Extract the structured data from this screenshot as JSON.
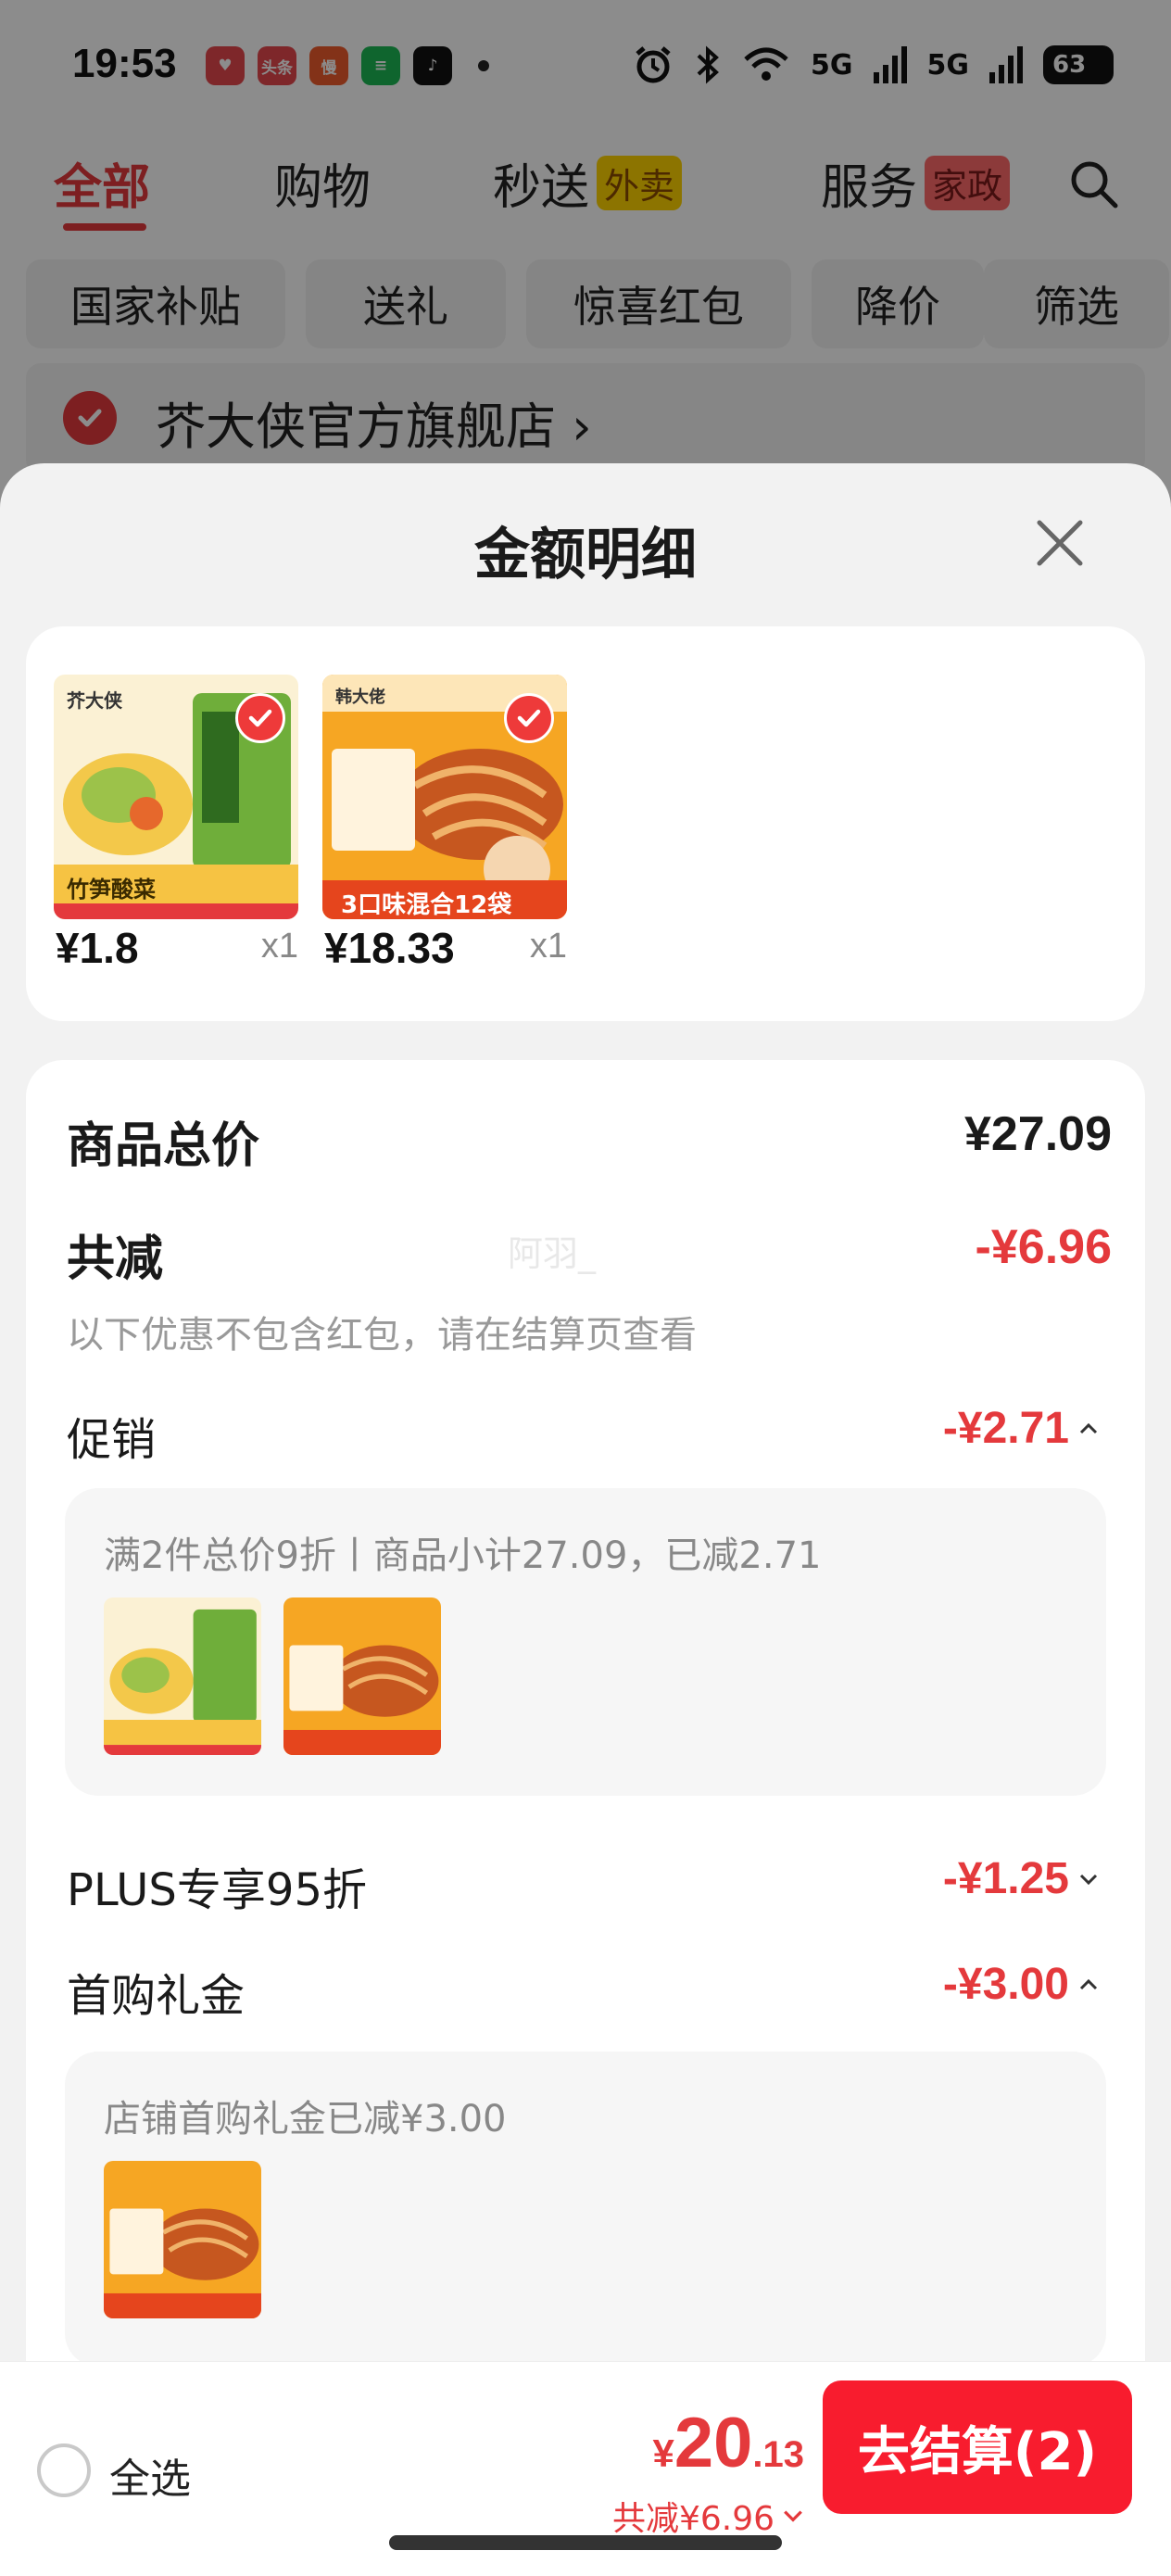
{
  "status_bar": {
    "time": "19:53",
    "apps": [
      {
        "label": "♥",
        "color": "#e5484d"
      },
      {
        "label": "头条",
        "color": "#e5484d"
      },
      {
        "label": "慢",
        "color": "#ef5b2c"
      },
      {
        "label": "≡",
        "color": "#1db954"
      },
      {
        "label": "♪",
        "color": "#111111"
      }
    ],
    "network": "5G",
    "battery": "63"
  },
  "top_tabs": {
    "all": "全部",
    "shopping": "购物",
    "express": "秒送",
    "express_badge": "外卖",
    "service": "服务",
    "service_badge": "家政"
  },
  "filter_chips": [
    "国家补贴",
    "送礼",
    "惊喜红包",
    "降价",
    "筛选"
  ],
  "store": {
    "name": "芥大侠官方旗舰店 ›"
  },
  "sheet": {
    "title": "金额明细",
    "watermark": "阿羽_",
    "products": [
      {
        "price": "¥1.8",
        "qty": "x1",
        "img_label": "竹笋酸菜",
        "brand": "芥大侠"
      },
      {
        "price": "¥18.33",
        "qty": "x1",
        "img_label": "3口味混合12袋",
        "brand": "韩大佬"
      }
    ],
    "total_label": "商品总价",
    "total_value": "¥27.09",
    "reduce_label": "共减",
    "reduce_value": "-¥6.96",
    "reduce_note": "以下优惠不包含红包，请在结算页查看",
    "promo": {
      "label": "促销",
      "value": "-¥2.71",
      "detail": "满2件总价9折丨商品小计27.09，已减2.71"
    },
    "plus": {
      "label": "PLUS专享95折",
      "value": "-¥1.25"
    },
    "first_gift": {
      "label": "首购礼金",
      "value": "-¥3.00",
      "detail": "店铺首购礼金已减¥3.00"
    }
  },
  "bottom_bar": {
    "select_all": "全选",
    "price_currency": "¥",
    "price_int": "20",
    "price_dec": ".13",
    "saving": "共减¥6.96",
    "checkout": "去结算(2)"
  },
  "colors": {
    "accent": "#e4393c",
    "checkout": "#f81c2e"
  }
}
